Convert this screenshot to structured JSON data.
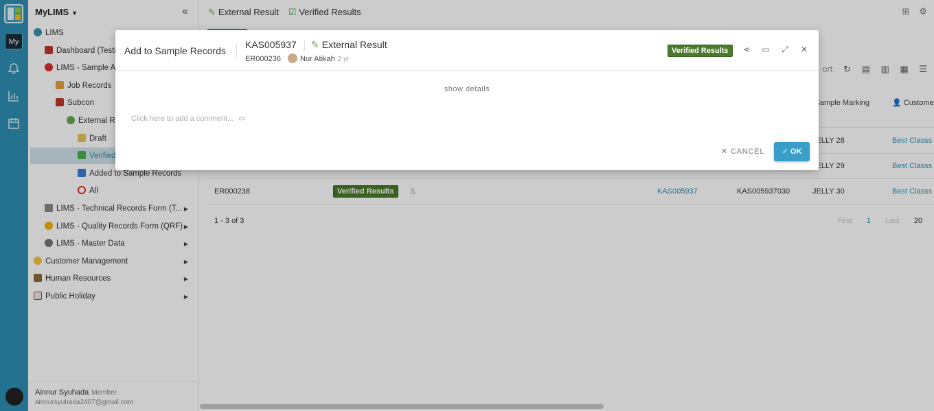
{
  "app": {
    "workspace": "MyLIMS",
    "workspace_badge": "My"
  },
  "sidebar": {
    "items": [
      {
        "label": "LIMS"
      },
      {
        "label": "Dashboard (Testi"
      },
      {
        "label": "LIMS - Sample Ac"
      },
      {
        "label": "Job Records"
      },
      {
        "label": "Subcon"
      },
      {
        "label": "External Re"
      },
      {
        "label": "Draft"
      },
      {
        "label": "Verified"
      },
      {
        "label": "Added to Sample Records"
      },
      {
        "label": "All"
      },
      {
        "label": "LIMS - Technical Records Form (T..."
      },
      {
        "label": "LIMS - Quality Records Form (QRF)"
      },
      {
        "label": "LIMS - Master Data"
      },
      {
        "label": "Customer Management"
      },
      {
        "label": "Human Resources"
      },
      {
        "label": "Public Holiday"
      }
    ],
    "user": {
      "name": "Ainnur Syuhada",
      "role": "Member",
      "email": "ainnursyuhada2407@gmail.com"
    }
  },
  "header": {
    "crumb1": "External Result",
    "crumb2": "Verified Results"
  },
  "toolbar": {
    "export_partial": "ort"
  },
  "table": {
    "col_sample_marking": "Sample Marking",
    "col_customer": "Custome",
    "rows": [
      {
        "marking": "JELLY 28",
        "customer": "Best Classs"
      },
      {
        "marking": "JELLY 29",
        "customer": "Best Classs"
      },
      {
        "id": "ER000238",
        "status": "Verified Results",
        "record": "KAS005937",
        "sample": "KAS005937030",
        "marking": "JELLY 30",
        "customer": "Best Classs"
      }
    ],
    "count": "1 - 3 of 3",
    "pager": {
      "first": "First",
      "page": "1",
      "last": "Last",
      "size": "20"
    }
  },
  "modal": {
    "title": "Add to Sample Records",
    "record_id": "KAS005937",
    "record_type": "External Result",
    "sub_id": "ER000236",
    "author": "Nur Atikah",
    "ago": "2 yr",
    "status_badge": "Verified Results",
    "show_details": "show details",
    "comment_placeholder": "Click here to add a comment...",
    "cancel_label": "CANCEL",
    "ok_label": "OK"
  },
  "colors": {
    "rail": "#2e8fb3",
    "badge": "#4a7a2a",
    "ok_button": "#3a9fc8",
    "link": "#2e8fb3"
  }
}
